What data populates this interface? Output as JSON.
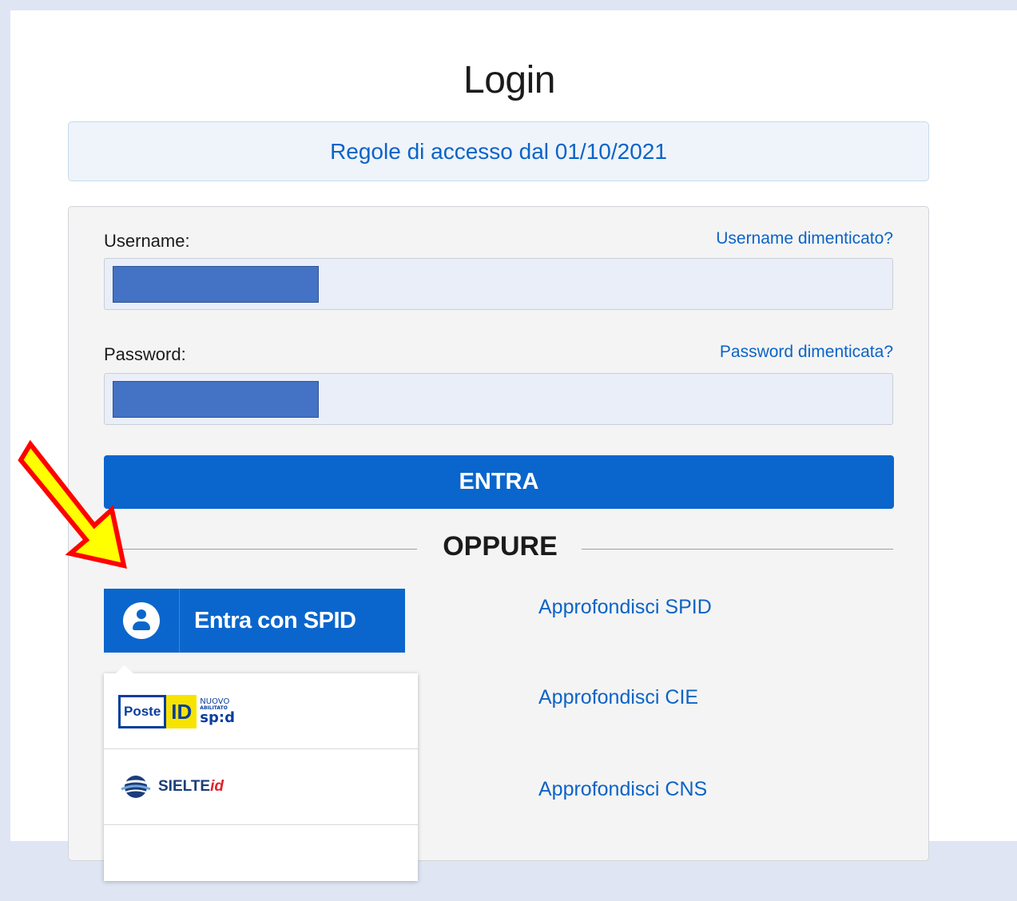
{
  "title": "Login",
  "notice": "Regole di accesso dal 01/10/2021",
  "form": {
    "username_label": "Username:",
    "username_forgot": "Username dimenticato?",
    "password_label": "Password:",
    "password_forgot": "Password dimenticata?",
    "submit_label": "ENTRA",
    "separator": "OPPURE"
  },
  "spid": {
    "button_label": "Entra con SPID",
    "providers": [
      {
        "name": "Poste ID",
        "logo_text_main": "Poste",
        "logo_text_id": "ID",
        "logo_badge_top": "NUOVO",
        "logo_badge_mid": "ABILITATO",
        "logo_badge_bottom": "sp:d"
      },
      {
        "name": "SIELTE id",
        "logo_text_main": "SIELTE",
        "logo_text_id": "id"
      }
    ]
  },
  "links": {
    "spid": "Approfondisci SPID",
    "cie": "Approfondisci CIE",
    "cns": "Approfondisci CNS"
  },
  "colors": {
    "primary": "#0a66cc",
    "link": "#0c63c7",
    "annotation_arrow_fill": "#ffff00",
    "annotation_arrow_stroke": "#ff0000",
    "redaction": "#4472c4"
  }
}
